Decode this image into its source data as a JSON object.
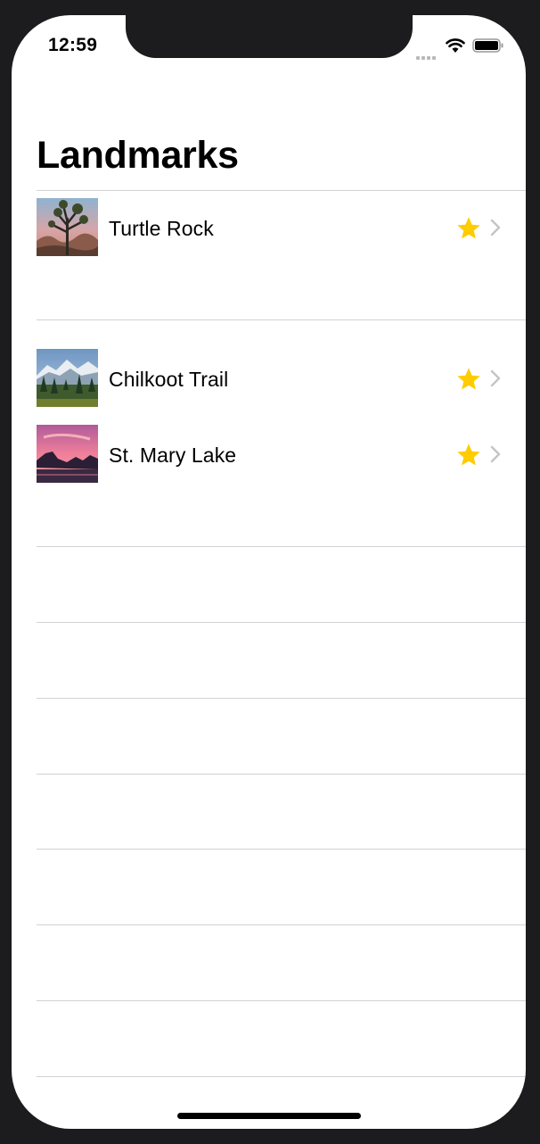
{
  "status_bar": {
    "time": "12:59",
    "icons": [
      "signal-icon",
      "wifi-icon",
      "battery-icon"
    ]
  },
  "navigation": {
    "large_title": "Landmarks"
  },
  "list": {
    "items": [
      {
        "name": "Turtle Rock",
        "thumbnail": "turtle-rock-photo",
        "favorite": true
      },
      {
        "name": "Chilkoot Trail",
        "thumbnail": "chilkoot-trail-photo",
        "favorite": true
      },
      {
        "name": "St. Mary Lake",
        "thumbnail": "st-mary-lake-photo",
        "favorite": true
      }
    ]
  },
  "colors": {
    "star": "#FFCC00",
    "chevron": "#C4C4C7",
    "separator": "#D2D2D6",
    "bezel": "#1C1C1E"
  }
}
